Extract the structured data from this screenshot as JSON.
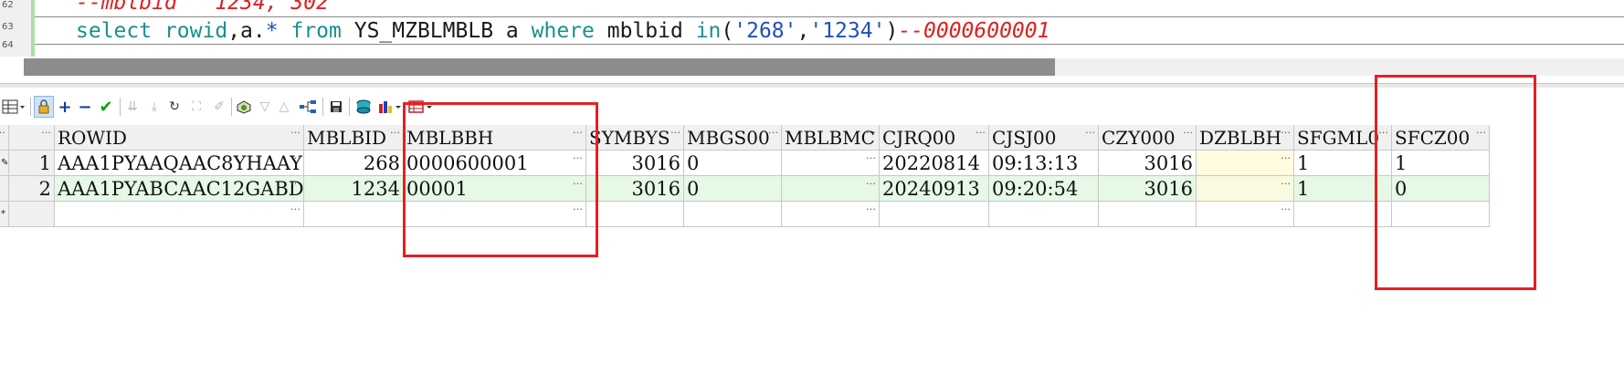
{
  "editor": {
    "line_numbers": [
      "62",
      "63",
      "64"
    ],
    "line62_text": "--mblbid   1234, 302",
    "line63": {
      "kw_select": "select",
      "id_rowid": "rowid",
      "punct1": ",a.",
      "star": "*",
      "kw_from": "from",
      "table": "YS_MZBLMBLB",
      "alias": "a",
      "kw_where": "where",
      "col": "mblbid",
      "kw_in": "in",
      "open": "(",
      "str1": "'268'",
      "comma": ",",
      "str2": "'1234'",
      "close": ")",
      "comment": "--0000600001"
    }
  },
  "toolbar": {
    "icons": [
      "grid-menu-icon",
      "lock-icon",
      "plus-icon",
      "minus-icon",
      "check-icon",
      "down-arrows-icon",
      "down-arrows-end-icon",
      "refresh-icon",
      "binoculars-icon",
      "clear-icon",
      "query-icon",
      "triangle-down-icon",
      "triangle-up-icon",
      "tree-icon",
      "save-icon",
      "export-icon",
      "chart-icon",
      "table-icon"
    ]
  },
  "grid": {
    "columns": [
      "ROWID",
      "MBLBID",
      "MBLBBH",
      "SYMBYS",
      "MBGS00",
      "MBLBMC",
      "CJRQ00",
      "CJSJ00",
      "CZY000",
      "DZBLBH",
      "SFGML0",
      "SFCZ00"
    ],
    "rows": [
      {
        "indicator": "✎",
        "num": "1",
        "cells": [
          "AAA1PYAAQAAC8YHAAY",
          "268",
          "0000600001",
          "3016",
          "0",
          "",
          "20220814",
          "09:13:13",
          "3016",
          "",
          "1",
          "1"
        ]
      },
      {
        "indicator": "",
        "num": "2",
        "cells": [
          "AAA1PYABCAAC12GABD",
          "1234",
          "00001",
          "3016",
          "0",
          "",
          "20240913",
          "09:20:54",
          "3016",
          "",
          "1",
          "0"
        ]
      },
      {
        "indicator": "*",
        "num": "",
        "cells": [
          "",
          "",
          "",
          "",
          "",
          "",
          "",
          "",
          "",
          "",
          "",
          ""
        ]
      }
    ]
  },
  "colors": {
    "highlight_box": "#e62020",
    "row_alt": "#e6f8e6",
    "keyword": "#1a8f8f",
    "string": "#2050c0",
    "comment": "#e02020"
  }
}
